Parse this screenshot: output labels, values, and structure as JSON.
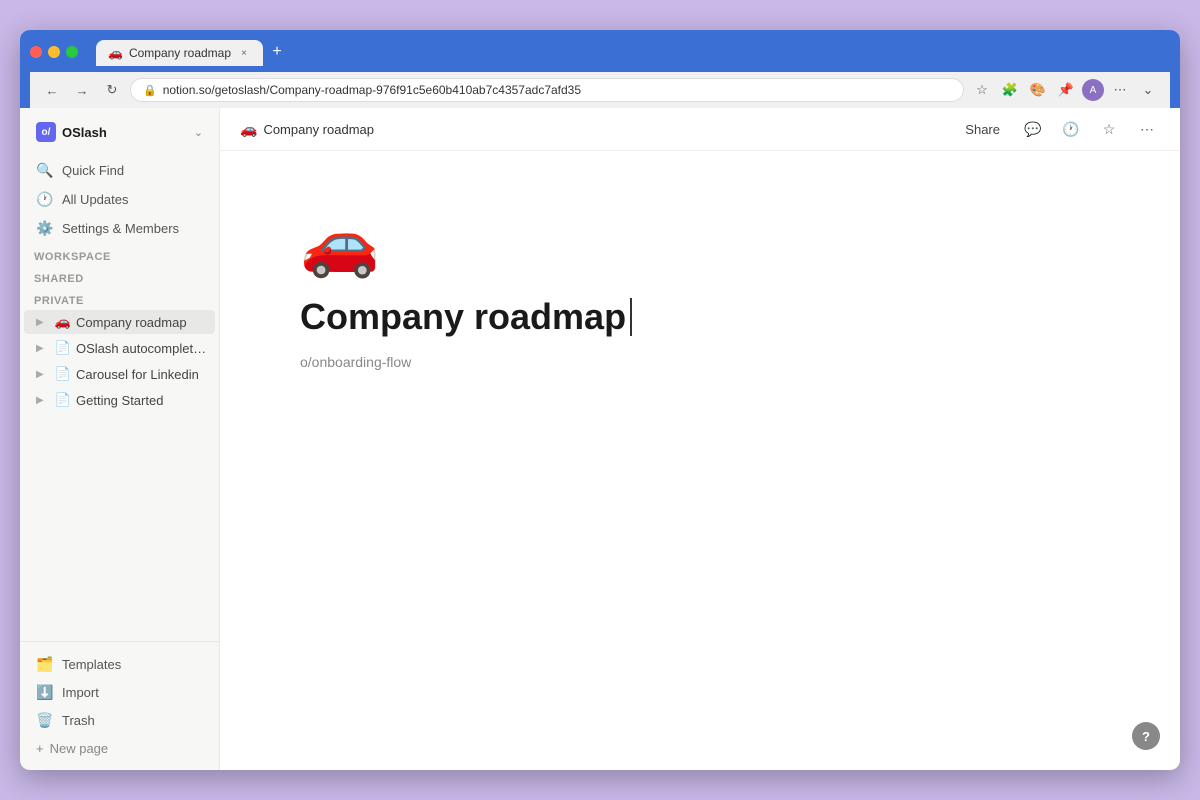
{
  "browser": {
    "tab_favicon": "🚗",
    "tab_title": "Company roadmap",
    "tab_close": "×",
    "tab_new": "+",
    "nav_back": "←",
    "nav_forward": "→",
    "nav_refresh": "↻",
    "address_url": "notion.so/getoslash/Company-roadmap-976f91c5e60b410ab7c4357adc7afd35",
    "nav_more": "⋯",
    "chevron_down": "⌄"
  },
  "sidebar": {
    "workspace_icon": "o/",
    "workspace_name": "OSlash",
    "workspace_chevron": "⌄",
    "nav_items": [
      {
        "id": "quick-find",
        "icon": "🔍",
        "label": "Quick Find"
      },
      {
        "id": "all-updates",
        "icon": "🕐",
        "label": "All Updates"
      },
      {
        "id": "settings",
        "icon": "⚙️",
        "label": "Settings & Members"
      }
    ],
    "section_workspace": "WORKSPACE",
    "section_shared": "SHARED",
    "section_private": "PRIVATE",
    "pages": [
      {
        "id": "company-roadmap",
        "icon": "🚗",
        "label": "Company roadmap",
        "active": true
      },
      {
        "id": "oslash-autocomplete",
        "icon": "📄",
        "label": "OSlash autocomplete ...",
        "active": false
      },
      {
        "id": "carousel-linkedin",
        "icon": "📄",
        "label": "Carousel for Linkedin",
        "active": false
      },
      {
        "id": "getting-started",
        "icon": "📄",
        "label": "Getting Started",
        "active": false
      }
    ],
    "bottom_items": [
      {
        "id": "templates",
        "icon": "🗂️",
        "label": "Templates"
      },
      {
        "id": "import",
        "icon": "⬇️",
        "label": "Import"
      },
      {
        "id": "trash",
        "icon": "🗑️",
        "label": "Trash"
      }
    ],
    "new_page_label": "New page",
    "new_page_plus": "+"
  },
  "page_header": {
    "breadcrumb_icon": "🚗",
    "breadcrumb_title": "Company roadmap",
    "share_label": "Share",
    "comment_icon": "💬",
    "history_icon": "🕐",
    "star_icon": "☆",
    "more_icon": "⋯"
  },
  "page": {
    "emoji": "🚗",
    "title": "Company roadmap",
    "subtitle": "o/onboarding-flow"
  },
  "help": {
    "label": "?"
  }
}
